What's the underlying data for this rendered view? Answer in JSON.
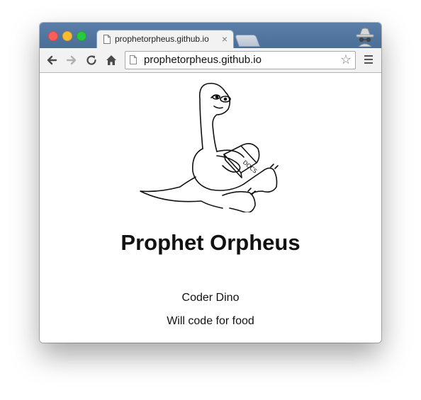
{
  "browser": {
    "tab": {
      "title": "prophetorpheus.github.io",
      "close_glyph": "×"
    },
    "address_bar": {
      "url": "prophetorpheus.github.io"
    },
    "icons": [
      "back-icon",
      "forward-icon",
      "reload-icon",
      "home-icon",
      "page-icon",
      "star-icon",
      "menu-icon",
      "incognito-icon"
    ]
  },
  "page": {
    "title": "Prophet Orpheus",
    "subtitle": "Coder Dino",
    "tagline": "Will code for food",
    "illustration_text": "DOCS"
  }
}
